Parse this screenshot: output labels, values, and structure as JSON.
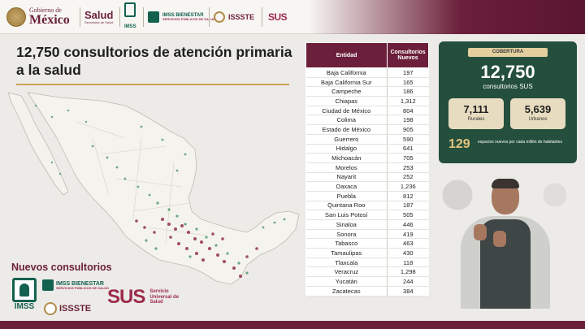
{
  "header": {
    "gob_small": "Gobierno de",
    "gob_big": "México",
    "salud": "Salud",
    "salud_sub": "Secretaría de Salud",
    "imss": "IMSS",
    "bienestar": "IMSS BIENESTAR",
    "bienestar_sub": "SERVICIOS PÚBLICOS DE SALUD",
    "issste": "ISSSTE",
    "sus": "SUS"
  },
  "title": "12,750 consultorios de atención primaria a la salud",
  "map_section_label": "Nuevos consultorios",
  "footer_logos": {
    "imss": "IMSS",
    "bienestar": "IMSS BIENESTAR",
    "bienestar_sub": "SERVICIOS PÚBLICOS DE SALUD",
    "issste": "ISSSTE",
    "sus": "SUS",
    "sus_desc": "Servicio Universal de Salud"
  },
  "table": {
    "headers": [
      "Entidad",
      "Consultorios Nuevos"
    ],
    "rows": [
      [
        "Baja California",
        "197"
      ],
      [
        "Baja California Sur",
        "165"
      ],
      [
        "Campeche",
        "186"
      ],
      [
        "Chiapas",
        "1,312"
      ],
      [
        "Ciudad de México",
        "804"
      ],
      [
        "Colima",
        "198"
      ],
      [
        "Estado de México",
        "905"
      ],
      [
        "Guerrero",
        "590"
      ],
      [
        "Hidalgo",
        "641"
      ],
      [
        "Michoacán",
        "705"
      ],
      [
        "Morelos",
        "253"
      ],
      [
        "Nayarit",
        "252"
      ],
      [
        "Oaxaca",
        "1,236"
      ],
      [
        "Puebla",
        "812"
      ],
      [
        "Quintana Roo",
        "187"
      ],
      [
        "San Luis Potosí",
        "505"
      ],
      [
        "Sinaloa",
        "446"
      ],
      [
        "Sonora",
        "419"
      ],
      [
        "Tabasco",
        "463"
      ],
      [
        "Tamaulipas",
        "430"
      ],
      [
        "Tlaxcala",
        "118"
      ],
      [
        "Veracruz",
        "1,298"
      ],
      [
        "Yucatán",
        "244"
      ],
      [
        "Zacatecas",
        "384"
      ]
    ]
  },
  "coverage": {
    "tag": "COBERTURA",
    "total": "12,750",
    "total_label": "consultorios SUS",
    "rural_value": "7,111",
    "rural_label": "Rurales",
    "urban_value": "5,639",
    "urban_label": "Urbanos",
    "per_million_value": "129",
    "per_million_text": "espacios nuevos por cada millón de habitantes"
  },
  "colors": {
    "guinda": "#6b1f3a",
    "green_panel": "#254f3d",
    "gold": "#c7a15a"
  }
}
